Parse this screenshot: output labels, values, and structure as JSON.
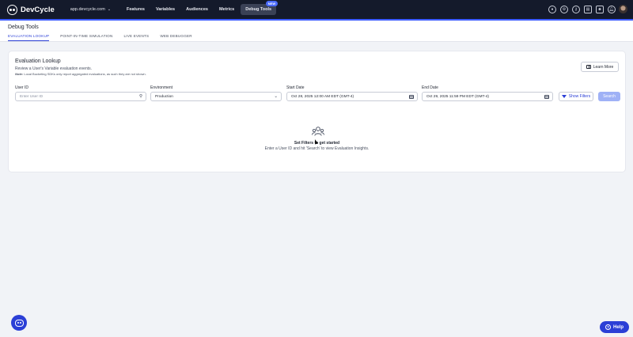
{
  "app": {
    "brand": "DevCycle",
    "project_selector": "app.devcycle.com"
  },
  "nav": {
    "items": [
      {
        "label": "Features"
      },
      {
        "label": "Variables"
      },
      {
        "label": "Audiences"
      },
      {
        "label": "Metrics"
      },
      {
        "label": "Debug Tools",
        "badge": "NEW"
      }
    ],
    "active": "Debug Tools",
    "icons": [
      "status-icon",
      "settings-icon",
      "key-icon",
      "docs-icon",
      "discord-icon",
      "notifications-icon"
    ]
  },
  "page": {
    "title": "Debug Tools",
    "tabs": [
      {
        "label": "EVALUATION LOOKUP",
        "active": true
      },
      {
        "label": "POINT-IN-TIME SIMULATION"
      },
      {
        "label": "LIVE EVENTS"
      },
      {
        "label": "WEB DEBUGGER"
      }
    ]
  },
  "lookup": {
    "title": "Evaluation Lookup",
    "subtitle": "Review a User's Variable evaluation events.",
    "note_label": "Note:",
    "note": "Local Bucketing SDKs only report aggregated evaluations, as such they are not shown.",
    "learn_more": "Learn More",
    "user_id": {
      "label": "User ID",
      "placeholder": "Enter User ID"
    },
    "environment": {
      "label": "Environment",
      "value": "Production"
    },
    "start_date": {
      "label": "Start Date",
      "value": "Oct 28, 2025 12:00 AM EDT (GMT-4)"
    },
    "end_date": {
      "label": "End Date",
      "value": "Oct 29, 2025 11:59 PM EDT (GMT-4)"
    },
    "show_filters": "Show Filters",
    "search": "Search",
    "empty_title": "Set Filters to get started",
    "empty_sub": "Enter a User ID and hit 'Search' to view Evaluation Insights."
  },
  "help": {
    "label": "Help"
  },
  "colors": {
    "accent": "#2b3fd6",
    "topbar": "#141a2b",
    "search_disabled": "#9fb1f6"
  }
}
